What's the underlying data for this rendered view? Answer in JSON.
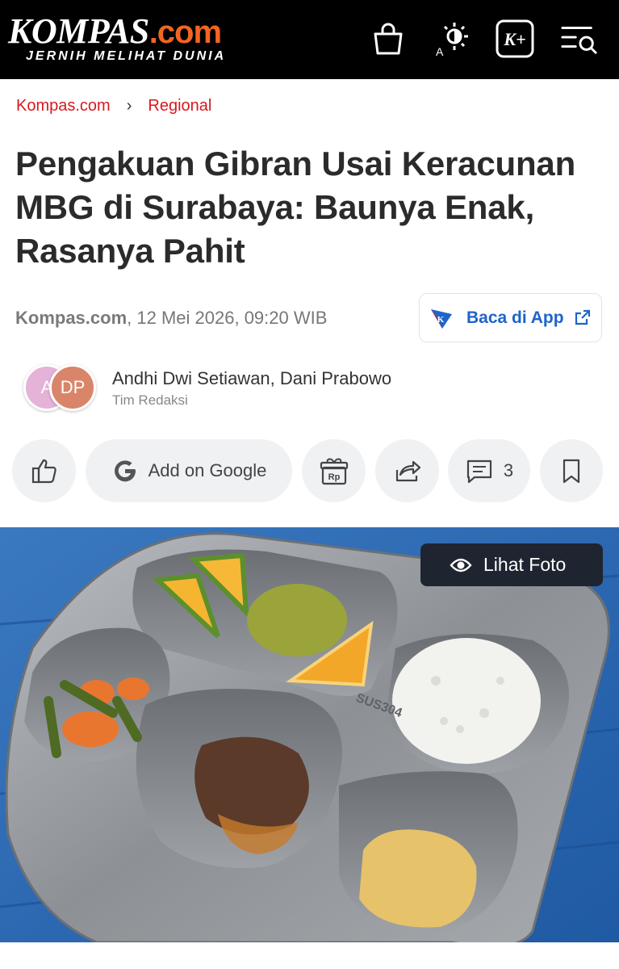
{
  "header": {
    "logo_main": "KOMPAS",
    "logo_dotcom": ".com",
    "tagline": "JERNIH MELIHAT DUNIA",
    "icons": [
      "shopping-bag-icon",
      "display-mode-icon",
      "kplus-icon",
      "search-menu-icon"
    ],
    "kplus_label": "K+"
  },
  "breadcrumb": {
    "home": "Kompas.com",
    "section": "Regional"
  },
  "article": {
    "title": "Pengakuan Gibran Usai Keracunan MBG di Surabaya: Baunya Enak, Rasanya Pahit",
    "source": "Kompas.com",
    "date": ", 12 Mei 2026, 09:20 WIB",
    "authors": "Andhi Dwi Setiawan,  Dani Prabowo",
    "team": "Tim Redaksi"
  },
  "app_button": {
    "label": "Baca di App"
  },
  "avatars": {
    "a1": "A",
    "a2": "DP"
  },
  "actions": {
    "google_label": "Add on Google",
    "comments_count": "3"
  },
  "photo": {
    "view_label": "Lihat Foto",
    "tray_text": "SUS304"
  },
  "colors": {
    "brand_red": "#d71920",
    "brand_orange": "#f26522",
    "link_blue": "#1f64c8",
    "header_bg": "#000000"
  }
}
